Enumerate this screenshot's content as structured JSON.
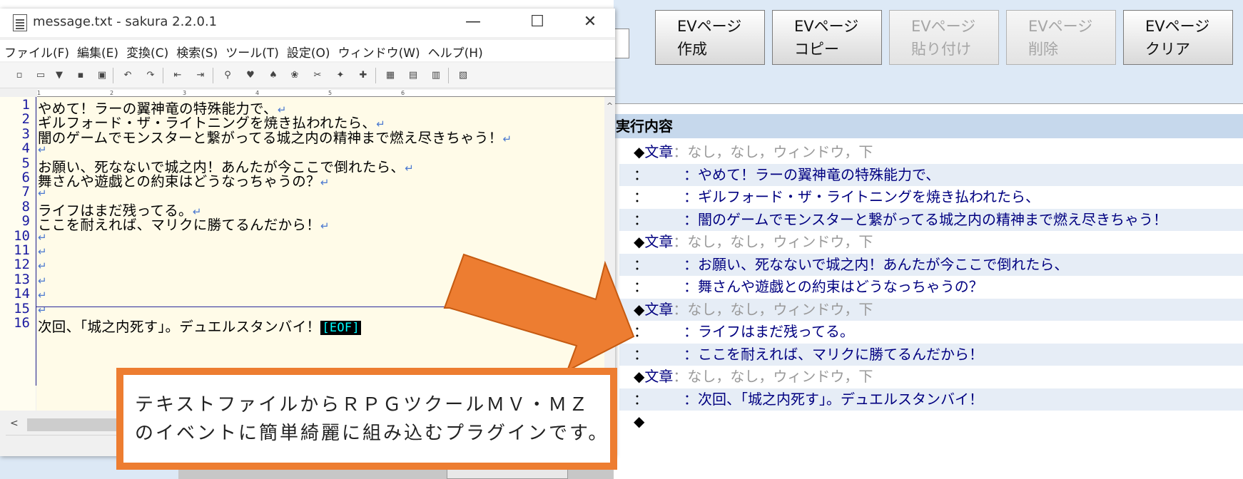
{
  "rpgmaker": {
    "buttons": [
      {
        "label": "EVページ\n作成",
        "enabled": true
      },
      {
        "label": "EVページ\nコピー",
        "enabled": true
      },
      {
        "label": "EVページ\n貼り付け",
        "enabled": false
      },
      {
        "label": "EVページ\n削除",
        "enabled": false
      },
      {
        "label": "EVページ\nクリア",
        "enabled": true
      }
    ],
    "exec_header": "実行内容",
    "exec_rows": [
      {
        "kind": "cmd",
        "marker": "◆",
        "label": "文章",
        "params": "：なし，なし，ウィンドウ，下"
      },
      {
        "kind": "text",
        "marker": "：",
        "text": "：やめて！ラーの翼神竜の特殊能力で、"
      },
      {
        "kind": "text",
        "marker": "：",
        "text": "：ギルフォード・ザ・ライトニングを焼き払われたら、"
      },
      {
        "kind": "text",
        "marker": "：",
        "text": "：闇のゲームでモンスターと繋がってる城之内の精神まで燃え尽きちゃう！"
      },
      {
        "kind": "cmd",
        "marker": "◆",
        "label": "文章",
        "params": "：なし，なし，ウィンドウ，下"
      },
      {
        "kind": "text",
        "marker": "：",
        "text": "：お願い、死なないで城之内！あんたが今ここで倒れたら、"
      },
      {
        "kind": "text",
        "marker": "：",
        "text": "：舞さんや遊戯との約束はどうなっちゃうの？"
      },
      {
        "kind": "cmd",
        "marker": "◆",
        "label": "文章",
        "params": "：なし，なし，ウィンドウ，下"
      },
      {
        "kind": "text",
        "marker": "：",
        "text": "：ライフはまだ残ってる。"
      },
      {
        "kind": "text",
        "marker": "：",
        "text": "：ここを耐えれば、マリクに勝てるんだから！"
      },
      {
        "kind": "cmd",
        "marker": "◆",
        "label": "文章",
        "params": "：なし，なし，ウィンドウ，下"
      },
      {
        "kind": "text",
        "marker": "：",
        "text": "：次回、「城之内死す」。デュエルスタンバイ！"
      },
      {
        "kind": "end",
        "marker": "◆",
        "text": ""
      }
    ]
  },
  "sakura": {
    "title": "message.txt - sakura 2.2.0.1",
    "window_controls": {
      "minimize": "—",
      "maximize": "☐",
      "close": "✕"
    },
    "menu": [
      "ファイル(F)",
      "編集(E)",
      "変換(C)",
      "検索(S)",
      "ツール(T)",
      "設定(O)",
      "ウィンドウ(W)",
      "ヘルプ(H)"
    ],
    "ruler_marks": [
      "1",
      "2",
      "3",
      "4",
      "5",
      "6"
    ],
    "lines": [
      {
        "num": "1",
        "text": "やめて！ラーの翼神竜の特殊能力で、",
        "ret": "↵"
      },
      {
        "num": "2",
        "text": "ギルフォード・ザ・ライトニングを焼き払われたら、",
        "ret": "↵"
      },
      {
        "num": "3",
        "text": "闇のゲームでモンスターと繋がってる城之内の精神まで燃え尽きちゃう！",
        "ret": "↵"
      },
      {
        "num": "4",
        "text": "",
        "ret": "↵"
      },
      {
        "num": "5",
        "text": "お願い、死なないで城之内！あんたが今ここで倒れたら、",
        "ret": "↵"
      },
      {
        "num": "6",
        "text": "舞さんや遊戯との約束はどうなっちゃうの？",
        "ret": "↵"
      },
      {
        "num": "7",
        "text": "",
        "ret": "↵"
      },
      {
        "num": "8",
        "text": "ライフはまだ残ってる。",
        "ret": "↵"
      },
      {
        "num": "9",
        "text": "ここを耐えれば、マリクに勝てるんだから！",
        "ret": "↵"
      },
      {
        "num": "10",
        "text": "",
        "ret": "↵"
      },
      {
        "num": "11",
        "text": "",
        "ret": "↵"
      },
      {
        "num": "12",
        "text": "",
        "ret": "↵"
      },
      {
        "num": "13",
        "text": "",
        "ret": "↵"
      },
      {
        "num": "14",
        "text": "",
        "ret": "↵"
      },
      {
        "num": "15",
        "text": "",
        "ret": "↵"
      },
      {
        "num": "16",
        "text": "次回、「城之内死す」。デュエルスタンバイ！",
        "ret": "",
        "eof": "[EOF]"
      }
    ],
    "scroll_left": "<",
    "scroll_up": "^"
  },
  "callout": {
    "text": "テキストファイルからＲＰＧツクールＭＶ・ＭＺ\nのイベントに簡単綺麗に組み込むプラグインです。"
  },
  "colors": {
    "accent_orange": "#ed7d31",
    "exec_text": "#000080",
    "line_number": "#1a1aa0",
    "eof_fg": "#00ffff"
  }
}
